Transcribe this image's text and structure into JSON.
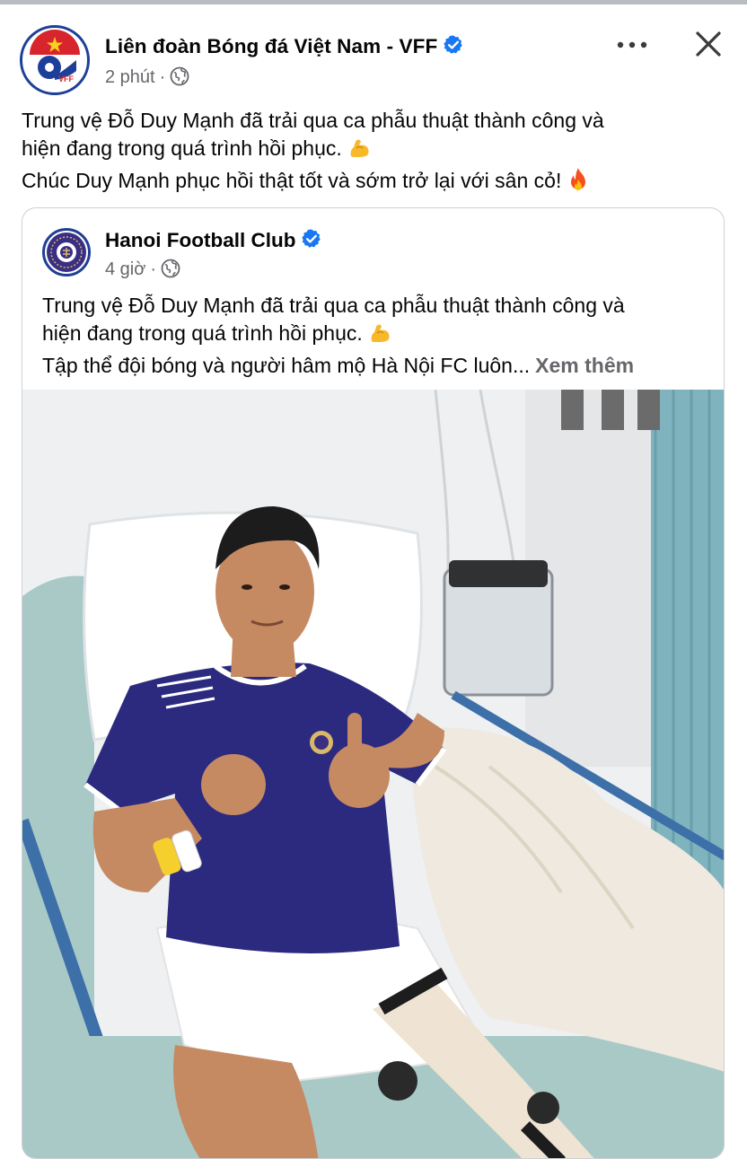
{
  "post": {
    "author": "Liên đoàn Bóng đá Việt Nam - VFF",
    "avatar_text": "VFF",
    "time": "2 phút",
    "separator": "·",
    "text_lines": [
      "Trung vệ Đỗ Duy Mạnh đã trải qua ca phẫu thuật thành công và",
      "hiện đang trong quá trình hồi phục.",
      "Chúc Duy Mạnh phục hồi thật tốt và sớm trở lại với sân cỏ!"
    ],
    "emojis": [
      "flexed-biceps",
      "fire"
    ]
  },
  "shared": {
    "author": "Hanoi Football Club",
    "time": "4 giờ",
    "separator": "·",
    "text_lines": [
      "Trung vệ Đỗ Duy Mạnh đã trải qua ca phẫu thuật thành công và",
      "hiện đang trong quá trình hồi phục.",
      "Tập thể đội bóng và người hâm mộ Hà Nội FC luôn..."
    ],
    "see_more": "Xem thêm",
    "photo_subject": "player-in-hospital-bed"
  },
  "icons": {
    "verified": "verified-badge-icon",
    "globe": "globe-icon",
    "more": "more-options-icon",
    "close": "close-icon"
  },
  "colors": {
    "verified_blue": "#1877f2",
    "meta_gray": "#65676b",
    "text": "#050505",
    "vff_blue": "#1d3f99",
    "hanoi_purple": "#3a2f83"
  }
}
